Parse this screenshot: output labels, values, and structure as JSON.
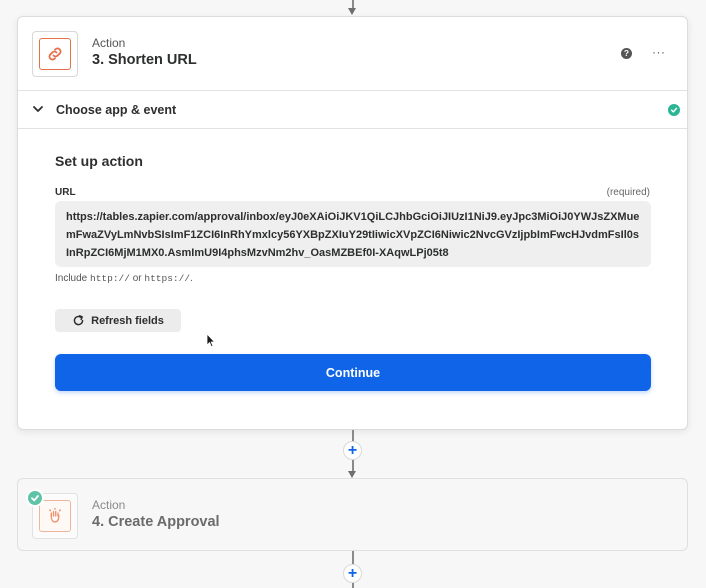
{
  "steps": [
    {
      "kind": "Action",
      "title": "3. Shorten URL",
      "app_icon": "link-icon",
      "header_actions": {
        "help_label": "?",
        "more_label": "···"
      },
      "section": {
        "title": "Choose app & event",
        "status_icon": "check-icon"
      },
      "setup": {
        "title": "Set up action",
        "field": {
          "label": "URL",
          "required_label": "(required)",
          "value": "https://tables.zapier.com/approval/inbox/eyJ0eXAiOiJKV1QiLCJhbGciOiJIUzI1NiJ9.eyJpc3MiOiJ0YWJsZXMuemFwaZVyLmNvbSIsImF1ZCI6InRhYmxlcy56YXBpZXIuY29tIiwicXVpZCI6Niwic2NvcGVzIjpbImFwcHJvdmFsIl0sInRpZCI6MjM1MX0.AsmImU9I4phsMzvNm2hv_OasMZBEf0I-XAqwLPj05t8",
          "hint_prefix": "Include ",
          "hint_code1": "http://",
          "hint_middle": " or ",
          "hint_code2": "https://",
          "hint_suffix": "."
        },
        "refresh_label": "Refresh fields",
        "continue_label": "Continue"
      }
    },
    {
      "kind": "Action",
      "title": "4. Create Approval",
      "app_icon": "approval-hand-icon",
      "status_icon": "check-icon"
    }
  ],
  "add_step_label": "+",
  "colors": {
    "primary": "#1064e8",
    "success": "#2bb594",
    "app_accent": "#e5704a"
  }
}
